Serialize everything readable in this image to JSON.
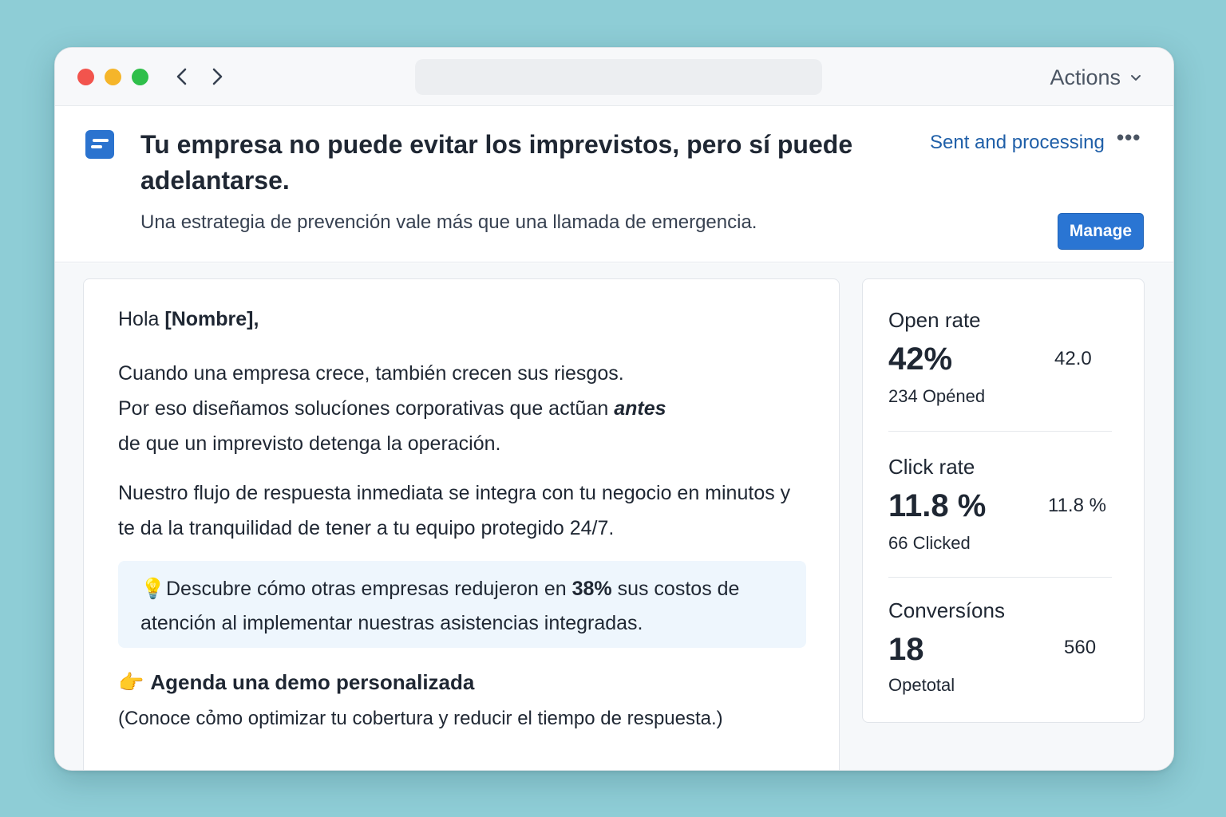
{
  "titlebar": {
    "actions_label": "Actions"
  },
  "header": {
    "subject": "Tu empresa no puede evitar los imprevistos, pero sí puede adelantarse.",
    "preheader": "Una estrategia de prevención vale más que una llamada de emergencia.",
    "status": "Sent and processing",
    "more_label": "•••",
    "manage_label": "Manage"
  },
  "email": {
    "greeting_prefix": "Hola ",
    "greeting_name": "[Nombre],",
    "para1_line1": "Cuando una empresa crece, también crecen sus riesgos.",
    "para1_line2": "Por eso diseñamos solucíones corporativas que actũan ",
    "para1_emphasis": "antes",
    "para1_line3": "de que un imprevisto detenga la operación.",
    "para2": "Nuestro flujo de respuesta inmediata se integra con tu negocio en minutos y te da la tranquilidad de tener a tu equipo protegido 24/7.",
    "callout_bulb": "💡",
    "callout_prefix": "Descubre cómo otras empresas redujeron en ",
    "callout_bold": "38%",
    "callout_suffix": " sus costos de atención al implementar nuestras asistencias integradas.",
    "cta_emoji": "👉",
    "cta_label": "Agenda una demo personalizada",
    "cta_note": "(Conoce cỏmo optimizar tu cobertura  y reducir el tiempo de respuesta.)"
  },
  "stats": [
    {
      "label": "Open rate",
      "value": "42%",
      "side": "42.0",
      "sub": "234 Opéned"
    },
    {
      "label": "Click rate",
      "value": "11.8 %",
      "side": "11.8 %",
      "sub": "66 Clicked"
    },
    {
      "label": "Conversíons",
      "value": "18",
      "side": "560",
      "sub": "Opetotal"
    }
  ]
}
